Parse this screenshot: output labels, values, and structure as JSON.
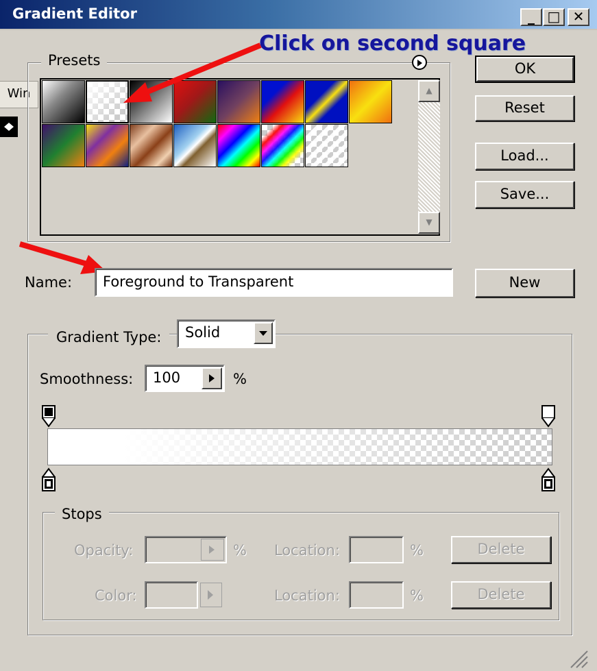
{
  "window": {
    "title": "Gradient Editor",
    "minimize": "_",
    "maximize": "□",
    "close": "✕"
  },
  "side_panel": {
    "tab_label": "Win"
  },
  "annotations": {
    "click_hint": "Click on second square"
  },
  "presets": {
    "label": "Presets",
    "swatches": [
      {
        "name": "Foreground to Background",
        "row": 1
      },
      {
        "name": "Foreground to Transparent",
        "row": 1,
        "selected": true
      },
      {
        "name": "Black, White",
        "row": 1
      },
      {
        "name": "Red, Green",
        "row": 1
      },
      {
        "name": "Violet, Orange",
        "row": 1
      },
      {
        "name": "Blue, Red, Yellow",
        "row": 1
      },
      {
        "name": "Blue, Yellow, Blue",
        "row": 1
      },
      {
        "name": "Orange, Yellow, Orange",
        "row": 1
      },
      {
        "name": "Violet, Green, Orange",
        "row": 2
      },
      {
        "name": "Yellow, Violet, Orange, Blue",
        "row": 2
      },
      {
        "name": "Copper",
        "row": 2
      },
      {
        "name": "Chrome",
        "row": 2
      },
      {
        "name": "Spectrum",
        "row": 2
      },
      {
        "name": "Transparent Rainbow",
        "row": 2
      },
      {
        "name": "Transparent Stripes",
        "row": 2
      }
    ]
  },
  "buttons": {
    "ok": "OK",
    "reset": "Reset",
    "load": "Load...",
    "save": "Save...",
    "new": "New"
  },
  "name_field": {
    "label": "Name:",
    "value": "Foreground to Transparent"
  },
  "gradient": {
    "type_label": "Gradient Type:",
    "type_value": "Solid",
    "smoothness_label": "Smoothness:",
    "smoothness_value": "100",
    "smoothness_unit": "%"
  },
  "stops": {
    "label": "Stops",
    "opacity_label": "Opacity:",
    "opacity_unit": "%",
    "color_label": "Color:",
    "location_label": "Location:",
    "location_unit": "%",
    "delete_label": "Delete"
  },
  "colors": {
    "title_bar_start": "#0a246a",
    "title_bar_end": "#a6caf0",
    "dialog_bg": "#d4d0c8",
    "annotation_text": "#16169c",
    "annotation_arrow": "#ee1010"
  }
}
